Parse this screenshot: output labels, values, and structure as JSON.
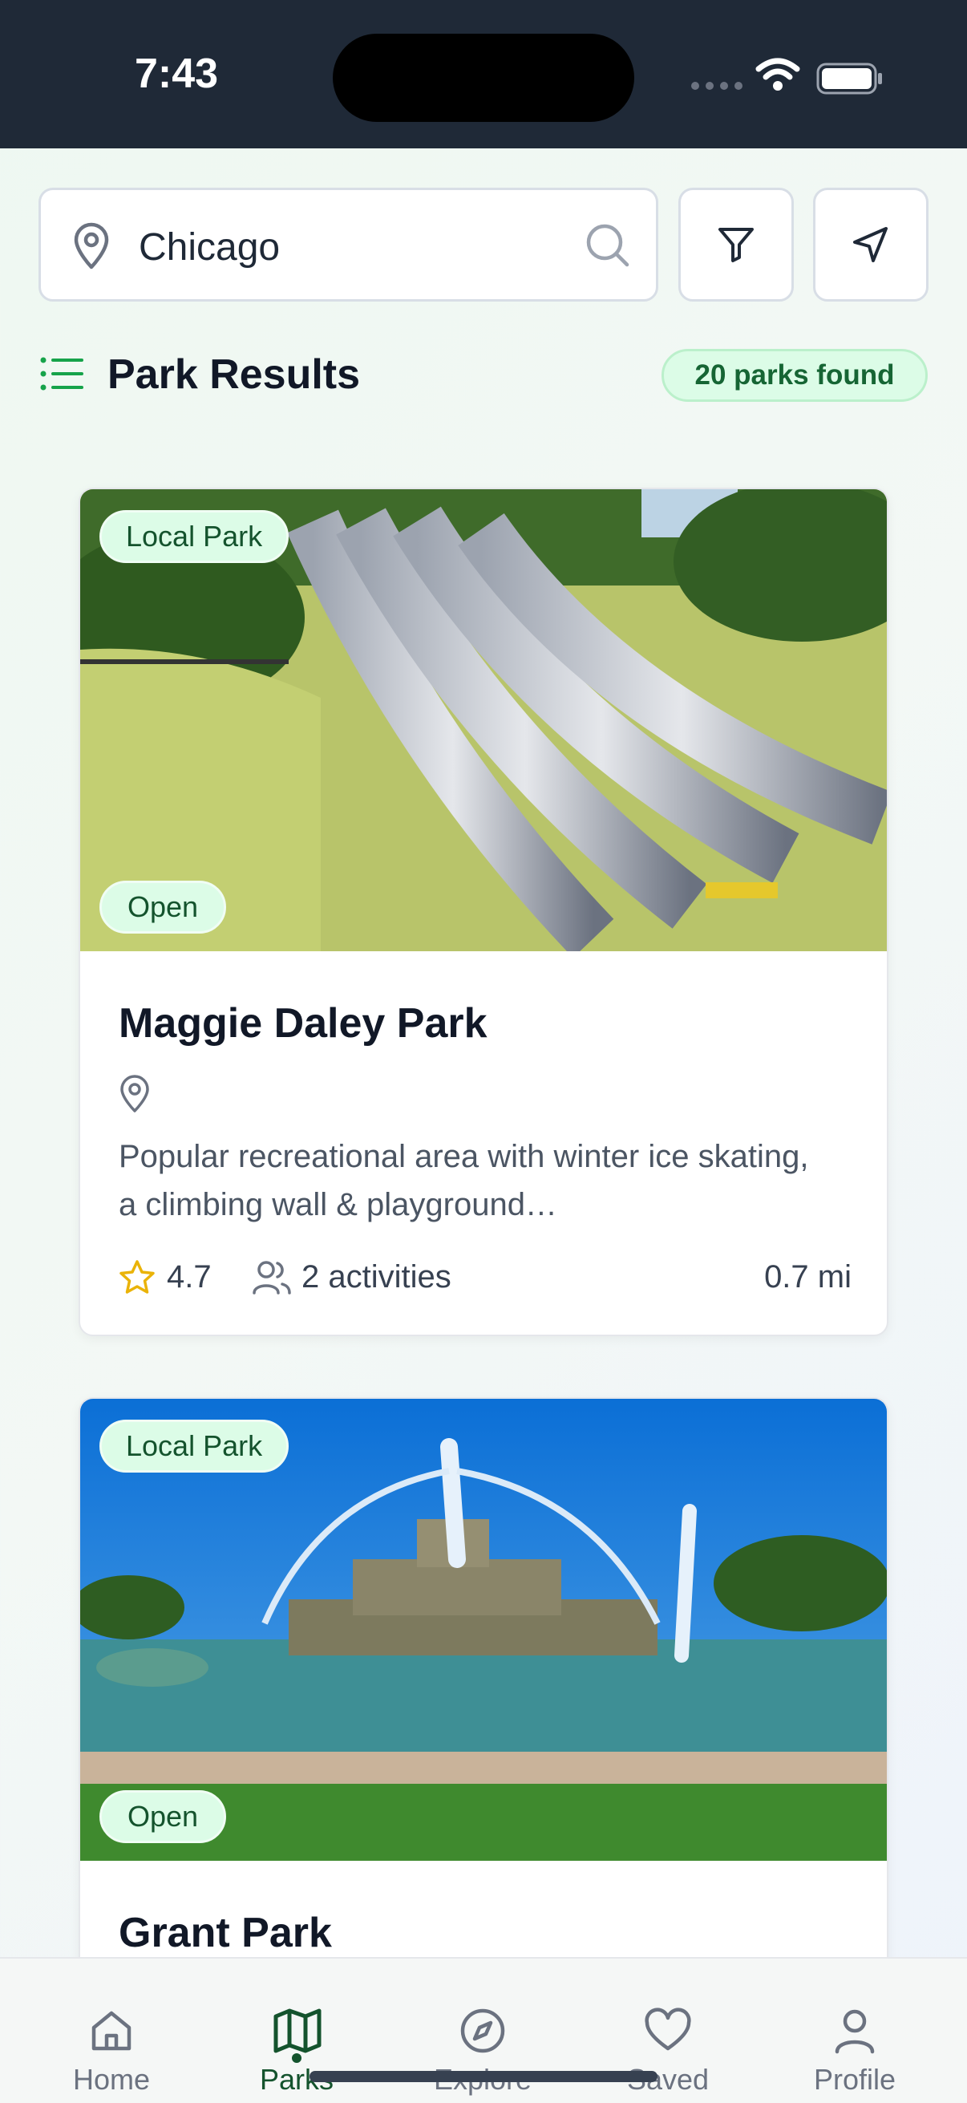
{
  "status_bar": {
    "time": "7:43"
  },
  "search": {
    "location_value": "Chicago"
  },
  "results": {
    "title": "Park Results",
    "count": "20 parks found"
  },
  "parks": [
    {
      "type": "Local Park",
      "status": "Open",
      "name": "Maggie Daley Park",
      "description": "Popular recreational area with winter ice skating, a climbing wall & playground…",
      "rating": "4.7",
      "activities": "2 activities",
      "distance": "0.7 mi"
    },
    {
      "type": "Local Park",
      "status": "Open",
      "name": "Grant Park"
    }
  ],
  "bottom_nav": {
    "items": [
      {
        "label": "Home",
        "icon": "home-icon"
      },
      {
        "label": "Parks",
        "icon": "map-icon",
        "active": true
      },
      {
        "label": "Explore",
        "icon": "compass-icon"
      },
      {
        "label": "Saved",
        "icon": "heart-icon"
      },
      {
        "label": "Profile",
        "icon": "user-icon"
      }
    ]
  },
  "colors": {
    "accent_green": "#15803d",
    "badge_bg": "#dcfce7",
    "badge_text": "#14532d",
    "star": "#eab308",
    "status_bar_bg": "#1f2937"
  }
}
